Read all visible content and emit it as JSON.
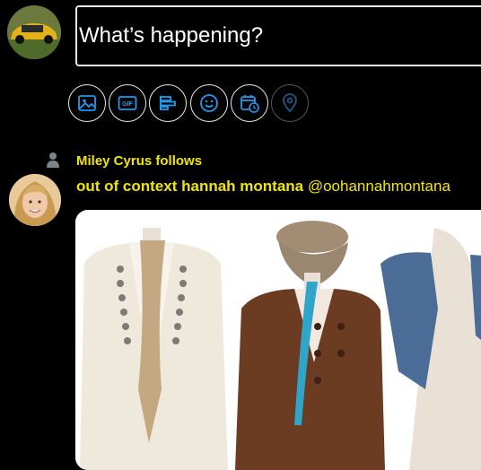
{
  "compose": {
    "placeholder": "What’s happening?",
    "tools": [
      "image-icon",
      "gif-icon",
      "poll-icon",
      "emoji-icon",
      "schedule-icon",
      "location-icon"
    ],
    "gif_label": "GIF"
  },
  "tweet": {
    "social_context": "Miley Cyrus follows",
    "author_name": "out of context hannah montana",
    "author_handle": "@oohannahmontana"
  },
  "colors": {
    "accent": "#1d9bf0",
    "highlight_text": "#f2e600",
    "background": "#000000"
  }
}
